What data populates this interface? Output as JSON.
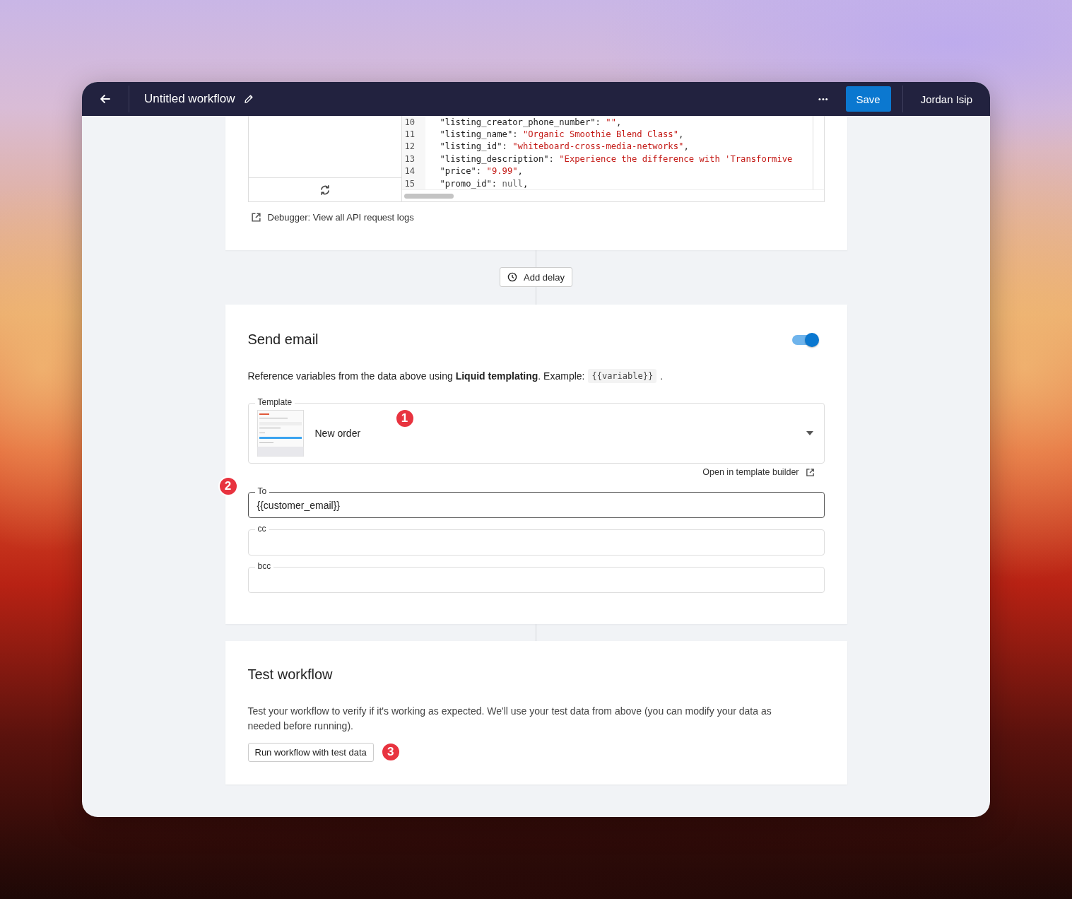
{
  "header": {
    "title": "Untitled workflow",
    "more": "•••",
    "save": "Save",
    "user": "Jordan Isip"
  },
  "code_panel": {
    "lines": [
      {
        "number": "10",
        "tokens": [
          {
            "kind": "key",
            "text": "\"listing_creator_phone_number\": "
          },
          {
            "kind": "string",
            "text": "\"\""
          },
          {
            "kind": "key",
            "text": ","
          }
        ]
      },
      {
        "number": "11",
        "tokens": [
          {
            "kind": "key",
            "text": "\"listing_name\": "
          },
          {
            "kind": "string",
            "text": "\"Organic Smoothie Blend Class\""
          },
          {
            "kind": "key",
            "text": ","
          }
        ]
      },
      {
        "number": "12",
        "tokens": [
          {
            "kind": "key",
            "text": "\"listing_id\": "
          },
          {
            "kind": "string",
            "text": "\"whiteboard-cross-media-networks\""
          },
          {
            "kind": "key",
            "text": ","
          }
        ]
      },
      {
        "number": "13",
        "tokens": [
          {
            "kind": "key",
            "text": "\"listing_description\": "
          },
          {
            "kind": "string",
            "text": "\"Experience the difference with 'Transformive"
          }
        ]
      },
      {
        "number": "14",
        "tokens": [
          {
            "kind": "key",
            "text": "\"price\": "
          },
          {
            "kind": "string",
            "text": "\"9.99\""
          },
          {
            "kind": "key",
            "text": ","
          }
        ]
      },
      {
        "number": "15",
        "tokens": [
          {
            "kind": "key",
            "text": "\"promo_id\": "
          },
          {
            "kind": "null",
            "text": "null"
          },
          {
            "kind": "key",
            "text": ","
          }
        ]
      }
    ],
    "debugger_link": "Debugger: View all API request logs"
  },
  "add_delay": "Add delay",
  "send_email": {
    "title": "Send email",
    "on": true,
    "description": "Reference variables from the data above using **Liquid templating**. Example:",
    "example": "{{variable}}",
    "description_end": ".",
    "template": {
      "label": "Template",
      "value": "New order",
      "marker": "1"
    },
    "template_builder_link": "Open in template builder",
    "fields": [
      {
        "label": "To",
        "value": "{{customer_email}}",
        "focused": true,
        "marker": "2"
      },
      {
        "label": "cc",
        "focused": false
      },
      {
        "label": "bcc",
        "focused": false
      }
    ]
  },
  "test_workflow": {
    "title": "Test workflow",
    "description": "Test your workflow to verify if it's working as expected. We'll use your test data from above (you can modify your data as needed before running).",
    "button": "Run workflow with test data",
    "marker": "3"
  }
}
